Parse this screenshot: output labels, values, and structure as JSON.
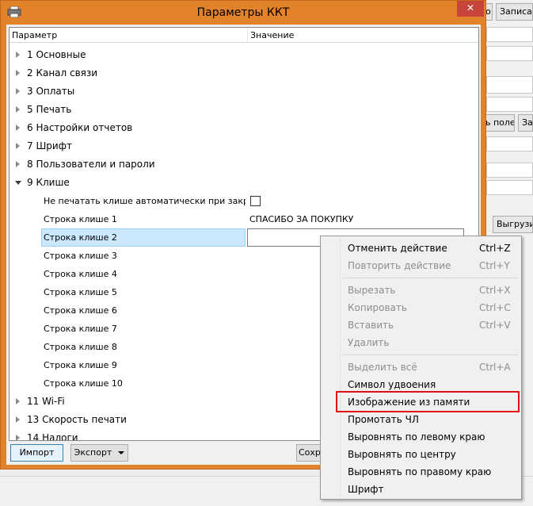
{
  "dialog": {
    "title": "Параметры ККТ",
    "close_glyph": "✕",
    "columns": {
      "param": "Параметр",
      "value": "Значение"
    }
  },
  "categories_top": [
    {
      "label": "1 Основные"
    },
    {
      "label": "2 Канал связи"
    },
    {
      "label": "3 Оплаты"
    },
    {
      "label": "5 Печать"
    },
    {
      "label": "6 Настройки отчетов"
    },
    {
      "label": "7 Шрифт"
    },
    {
      "label": "8 Пользователи и пароли"
    },
    {
      "label": "9 Клише"
    }
  ],
  "cliche_rows": [
    {
      "name": "Не печатать клише автоматически при закр…",
      "value": ""
    },
    {
      "name": "Строка клише 1",
      "value": "СПАСИБО ЗА ПОКУПКУ"
    },
    {
      "name": "Строка клише 2",
      "value": ""
    },
    {
      "name": "Строка клише 3",
      "value": ""
    },
    {
      "name": "Строка клише 4",
      "value": ""
    },
    {
      "name": "Строка клише 5",
      "value": ""
    },
    {
      "name": "Строка клише 6",
      "value": ""
    },
    {
      "name": "Строка клише 7",
      "value": ""
    },
    {
      "name": "Строка клише 8",
      "value": ""
    },
    {
      "name": "Строка клише 9",
      "value": ""
    },
    {
      "name": "Строка клише 10",
      "value": ""
    }
  ],
  "categories_bottom": [
    {
      "label": "11 Wi-Fi"
    },
    {
      "label": "13 Скорость печати"
    },
    {
      "label": "14 Налоги"
    }
  ],
  "buttons": {
    "import": "Импорт",
    "export": "Экспорт",
    "save": "Сохра"
  },
  "background_window": {
    "btn_top_left": "о",
    "btn_top_right": "Записат",
    "btn_mid_left": "ь поле",
    "btn_mid_right": "Запи",
    "btn_lower": "Выгрузит"
  },
  "context_menu": {
    "undo": {
      "label": "Отменить действие",
      "shortcut": "Ctrl+Z"
    },
    "redo": {
      "label": "Повторить действие",
      "shortcut": "Ctrl+Y"
    },
    "cut": {
      "label": "Вырезать",
      "shortcut": "Ctrl+X"
    },
    "copy": {
      "label": "Копировать",
      "shortcut": "Ctrl+C"
    },
    "paste": {
      "label": "Вставить",
      "shortcut": "Ctrl+V"
    },
    "delete": {
      "label": "Удалить",
      "shortcut": ""
    },
    "select_all": {
      "label": "Выделить всё",
      "shortcut": "Ctrl+A"
    },
    "double_symbol": {
      "label": "Символ удвоения"
    },
    "image_from_memory": {
      "label": "Изображение из памяти"
    },
    "feed_tape": {
      "label": "Промотать ЧЛ"
    },
    "align_left": {
      "label": "Выровнять по левому краю"
    },
    "align_center": {
      "label": "Выровнять по центру"
    },
    "align_right": {
      "label": "Выровнять по правому краю"
    },
    "font": {
      "label": "Шрифт"
    }
  },
  "colors": {
    "titlebar": "#e2822a",
    "close": "#c7443a",
    "highlight_box": "#e0101a",
    "selection": "#cce8ff"
  }
}
